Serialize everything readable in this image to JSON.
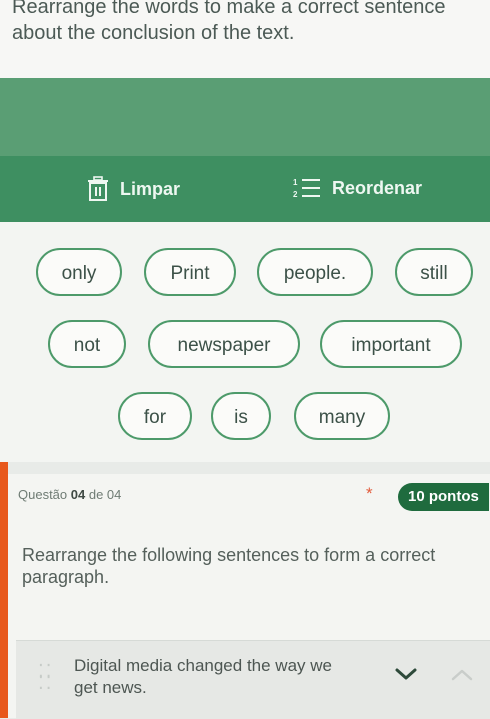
{
  "question1": {
    "prompt": "Rearrange the words to make a correct sentence about the conclusion of the text.",
    "toolbar": {
      "clear_label": "Limpar",
      "reorder_label": "Reordenar"
    },
    "word_chips": [
      "only",
      "Print",
      "people.",
      "still",
      "not",
      "newspaper",
      "important",
      "for",
      "is",
      "many"
    ]
  },
  "question2": {
    "number_prefix": "Questão ",
    "number": "04",
    "number_of": " de 04",
    "required_marker": "*",
    "points": "10 pontos",
    "prompt": "Rearrange the following sentences to form a correct paragraph.",
    "items": [
      {
        "text": "Digital media changed the way we get news."
      }
    ]
  },
  "colors": {
    "accent": "#3e8f61",
    "badge": "#1f6b3e",
    "side_strip": "#e8581c"
  }
}
